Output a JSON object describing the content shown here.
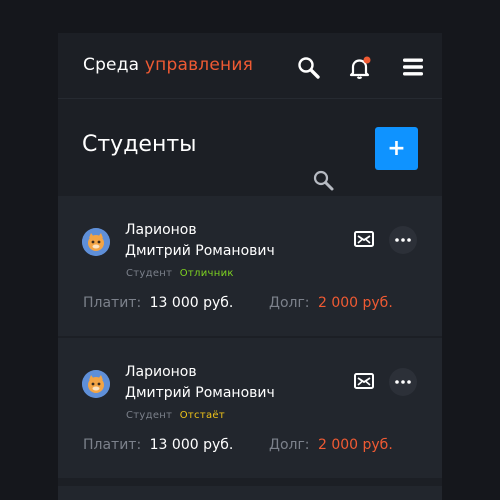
{
  "app": {
    "brand_part1": "Среда",
    "brand_part2": "управления",
    "accent": "#ef5a33",
    "primary": "#0f93ff"
  },
  "page": {
    "title": "Студенты",
    "add_label": "+"
  },
  "students": [
    {
      "last_name": "Ларионов",
      "first_names": "Дмитрий Романович",
      "role": "Студент",
      "status": "Отличник",
      "status_color": "#7ed321",
      "pays_label": "Платит:",
      "pays_value": "13 000 руб.",
      "debt_label": "Долг:",
      "debt_value": "2 000 руб."
    },
    {
      "last_name": "Ларионов",
      "first_names": "Дмитрий Романович",
      "role": "Студент",
      "status": "Отстаёт",
      "status_color": "#f0c419",
      "pays_label": "Платит:",
      "pays_value": "13 000 руб.",
      "debt_label": "Долг:",
      "debt_value": "2 000 руб."
    }
  ],
  "icons": [
    "search-icon",
    "bell-icon",
    "menu-icon",
    "mail-icon",
    "more-icon",
    "avatar"
  ]
}
